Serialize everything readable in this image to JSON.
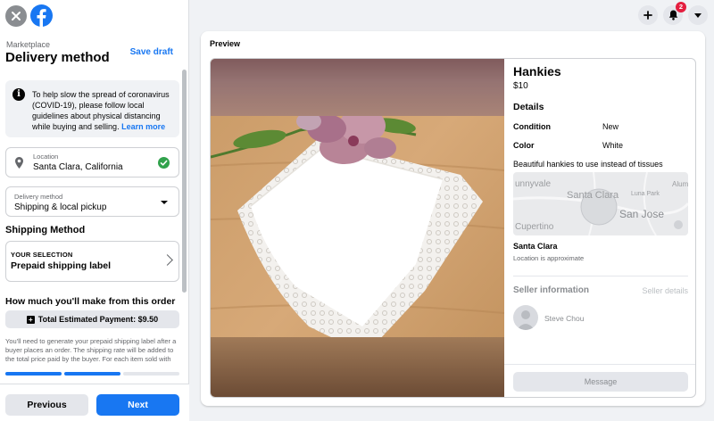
{
  "header": {
    "breadcrumb": "Marketplace",
    "title": "Delivery method",
    "save_draft": "Save draft",
    "notification_count": "2"
  },
  "notice": {
    "text": "To help slow the spread of coronavirus (COVID-19), please follow local guidelines about physical distancing while buying and selling.",
    "link": "Learn more"
  },
  "location": {
    "label": "Location",
    "value": "Santa Clara, California"
  },
  "delivery": {
    "label": "Delivery method",
    "value": "Shipping & local pickup"
  },
  "shipping": {
    "heading": "Shipping Method",
    "selection_label": "YOUR SELECTION",
    "selection_value": "Prepaid shipping label"
  },
  "earnings": {
    "heading": "How much you'll make from this order",
    "total_label": "Total Estimated Payment: $9.50",
    "fine_print": "You'll need to generate your prepaid shipping label after a buyer places an order. The shipping rate will be added to the total price paid by the buyer. For each item sold with"
  },
  "progress": {
    "steps_total": 3,
    "steps_done": 2
  },
  "nav": {
    "previous": "Previous",
    "next": "Next"
  },
  "preview": {
    "heading": "Preview",
    "item_title": "Hankies",
    "price": "$10",
    "details_heading": "Details",
    "details": [
      {
        "key": "Condition",
        "value": "New"
      },
      {
        "key": "Color",
        "value": "White"
      }
    ],
    "description": "Beautiful hankies to use instead of tissues",
    "map_labels": {
      "a": "unnyvale",
      "b": "Santa Clara",
      "c": "Luna Park",
      "d": "Alum",
      "e": "San Jose",
      "f": "Cupertino"
    },
    "city": "Santa Clara",
    "location_note": "Location is approximate",
    "seller_heading": "Seller information",
    "seller_details": "Seller details",
    "seller_name": "Steve Chou",
    "message_button": "Message"
  },
  "colors": {
    "accent": "#1877f2",
    "success": "#31a24c",
    "badge": "#e41e3f"
  }
}
